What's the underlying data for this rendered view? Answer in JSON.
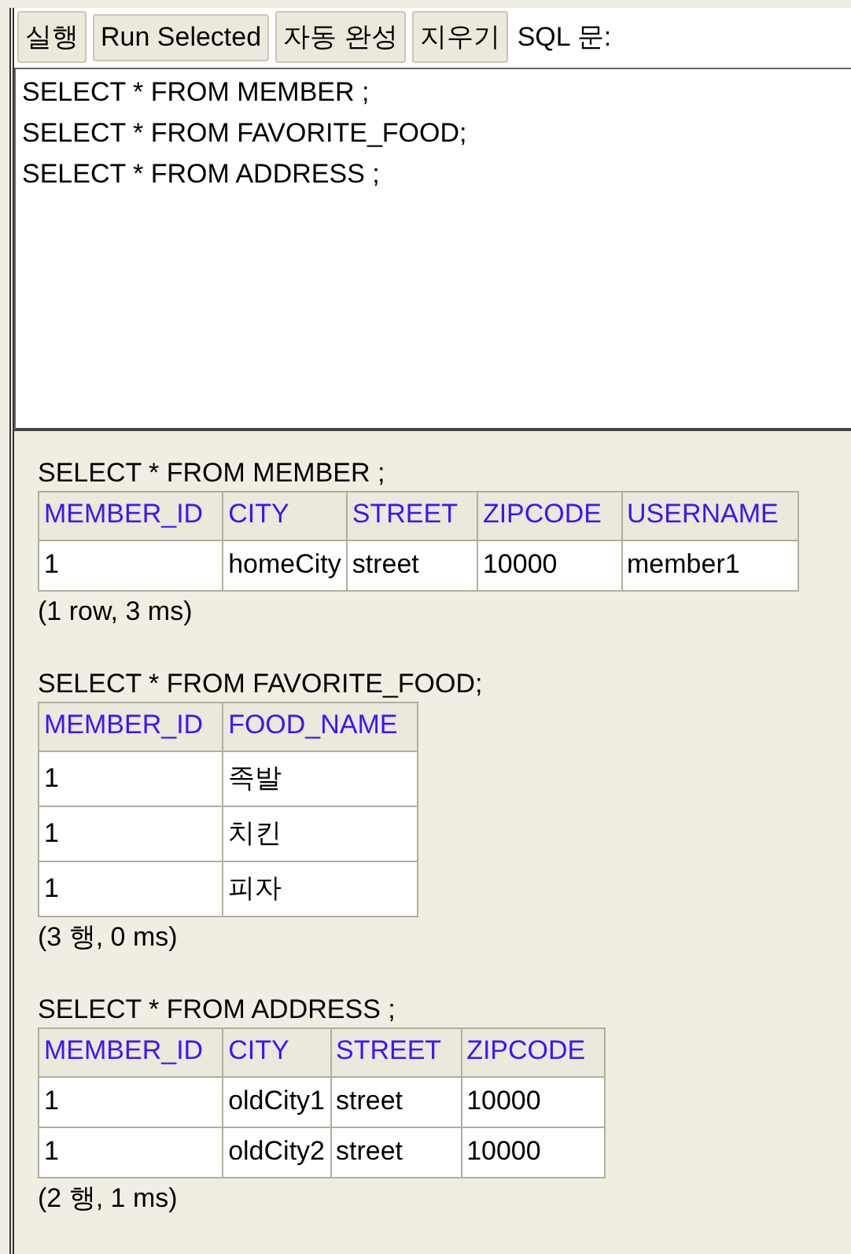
{
  "toolbar": {
    "buttons": [
      "실행",
      "Run Selected",
      "자동 완성",
      "지우기"
    ],
    "label": "SQL 문:"
  },
  "editor": {
    "lines": [
      "SELECT * FROM MEMBER ;",
      "SELECT * FROM FAVORITE_FOOD;",
      "SELECT * FROM ADDRESS ;"
    ]
  },
  "results": [
    {
      "query": "SELECT * FROM MEMBER ;",
      "columns": [
        "MEMBER_ID",
        "CITY",
        "STREET",
        "ZIPCODE",
        "USERNAME"
      ],
      "rows": [
        [
          "1",
          "homeCity",
          "street",
          "10000",
          "member1"
        ]
      ],
      "summary": "(1 row, 3 ms)"
    },
    {
      "query": "SELECT * FROM FAVORITE_FOOD;",
      "columns": [
        "MEMBER_ID",
        "FOOD_NAME"
      ],
      "rows": [
        [
          "1",
          "족발"
        ],
        [
          "1",
          "치킨"
        ],
        [
          "1",
          "피자"
        ]
      ],
      "summary": "(3 행, 0 ms)"
    },
    {
      "query": "SELECT * FROM ADDRESS ;",
      "columns": [
        "MEMBER_ID",
        "CITY",
        "STREET",
        "ZIPCODE"
      ],
      "rows": [
        [
          "1",
          "oldCity1",
          "street",
          "10000"
        ],
        [
          "1",
          "oldCity2",
          "street",
          "10000"
        ]
      ],
      "summary": "(2 행, 1 ms)"
    }
  ]
}
